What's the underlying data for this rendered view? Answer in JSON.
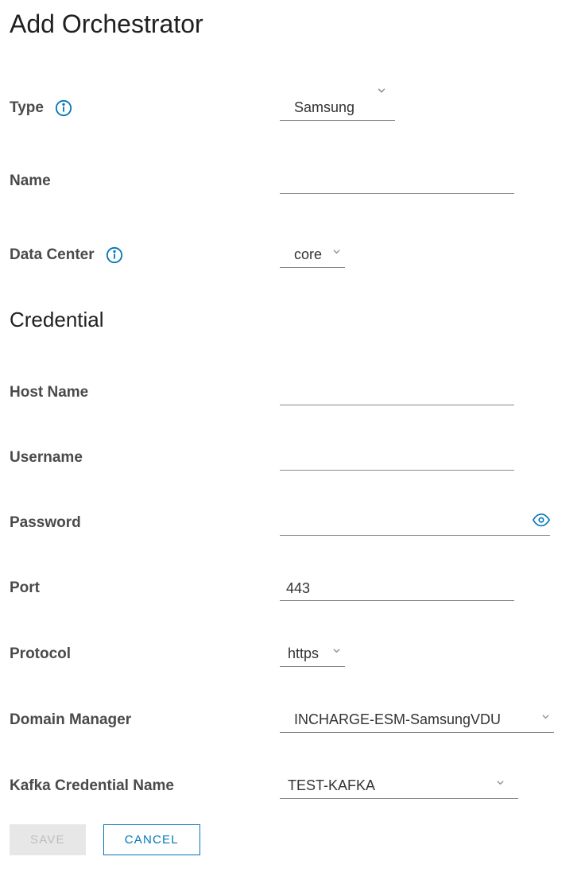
{
  "pageTitle": "Add Orchestrator",
  "fields": {
    "type": {
      "label": "Type",
      "value": "Samsung"
    },
    "name": {
      "label": "Name",
      "value": ""
    },
    "dataCenter": {
      "label": "Data Center",
      "value": "core"
    }
  },
  "credentialSection": {
    "heading": "Credential",
    "hostName": {
      "label": "Host Name",
      "value": ""
    },
    "username": {
      "label": "Username",
      "value": ""
    },
    "password": {
      "label": "Password",
      "value": ""
    },
    "port": {
      "label": "Port",
      "value": "443"
    },
    "protocol": {
      "label": "Protocol",
      "value": "https"
    },
    "domainManager": {
      "label": "Domain Manager",
      "value": "INCHARGE-ESM-SamsungVDU"
    },
    "kafkaCredentialName": {
      "label": "Kafka Credential Name",
      "value": "TEST-KAFKA"
    }
  },
  "buttons": {
    "save": "SAVE",
    "cancel": "CANCEL"
  },
  "colors": {
    "accent": "#0077b8",
    "text": "#4a4a4a"
  }
}
